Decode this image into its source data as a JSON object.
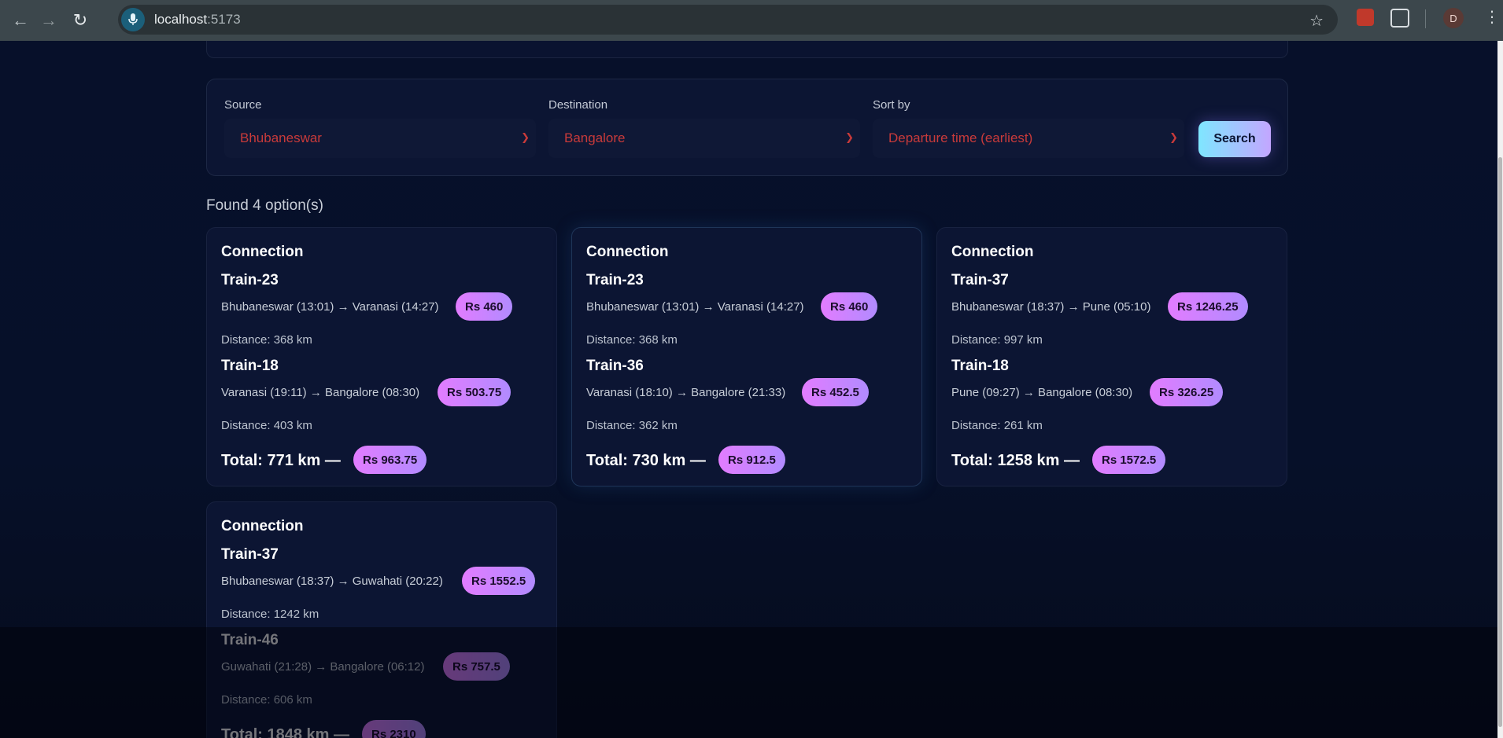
{
  "browser": {
    "url_host": "localhost",
    "url_port": ":5173",
    "profile_initial": "D"
  },
  "filters": {
    "source_label": "Source",
    "source_value": "Bhubaneswar",
    "destination_label": "Destination",
    "destination_value": "Bangalore",
    "sort_label": "Sort by",
    "sort_value": "Departure time (earliest)",
    "search_label": "Search"
  },
  "results": {
    "found_text": "Found 4 option(s)",
    "cards": [
      {
        "title": "Connection",
        "legs": [
          {
            "train": "Train-23",
            "route": "Bhubaneswar (13:01) → Varanasi (14:27)",
            "price": "Rs 460",
            "distance": "Distance: 368 km"
          },
          {
            "train": "Train-18",
            "route": "Varanasi (19:11) → Bangalore (08:30)",
            "price": "Rs 503.75",
            "distance": "Distance: 403 km"
          }
        ],
        "total": "Total: 771 km —",
        "total_price": "Rs 963.75"
      },
      {
        "title": "Connection",
        "legs": [
          {
            "train": "Train-23",
            "route": "Bhubaneswar (13:01) → Varanasi (14:27)",
            "price": "Rs 460",
            "distance": "Distance: 368 km"
          },
          {
            "train": "Train-36",
            "route": "Varanasi (18:10) → Bangalore (21:33)",
            "price": "Rs 452.5",
            "distance": "Distance: 362 km"
          }
        ],
        "total": "Total: 730 km —",
        "total_price": "Rs 912.5"
      },
      {
        "title": "Connection",
        "legs": [
          {
            "train": "Train-37",
            "route": "Bhubaneswar (18:37) → Pune (05:10)",
            "price": "Rs 1246.25",
            "distance": "Distance: 997 km"
          },
          {
            "train": "Train-18",
            "route": "Pune (09:27) → Bangalore (08:30)",
            "price": "Rs 326.25",
            "distance": "Distance: 261 km"
          }
        ],
        "total": "Total: 1258 km —",
        "total_price": "Rs 1572.5"
      },
      {
        "title": "Connection",
        "legs": [
          {
            "train": "Train-37",
            "route": "Bhubaneswar (18:37) → Guwahati (20:22)",
            "price": "Rs 1552.5",
            "distance": "Distance: 1242 km"
          },
          {
            "train": "Train-46",
            "route": "Guwahati (21:28) → Bangalore (06:12)",
            "price": "Rs 757.5",
            "distance": "Distance: 606 km"
          }
        ],
        "total": "Total: 1848 km —",
        "total_price": "Rs 2310"
      }
    ]
  }
}
